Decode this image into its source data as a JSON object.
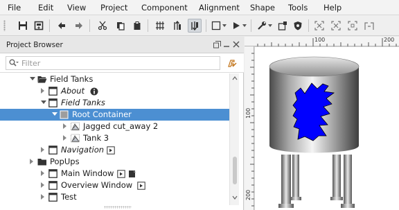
{
  "menu": {
    "file": "File",
    "edit": "Edit",
    "view": "View",
    "project": "Project",
    "component": "Component",
    "alignment": "Alignment",
    "shape": "Shape",
    "tools": "Tools",
    "help": "Help"
  },
  "toolbar": {
    "icons": [
      "save-icon",
      "save-all-icon",
      "back-icon",
      "forward-icon",
      "cut-icon",
      "copy-icon",
      "paste-icon",
      "group-icon",
      "bring-forward-icon",
      "send-backward-icon",
      "frame-icon",
      "dropdown-icon",
      "play-icon",
      "dropdown-icon",
      "wrench-icon",
      "dropdown-icon",
      "component-icon",
      "shield-icon",
      "expand-icon",
      "collapse-icon",
      "align-icon",
      "distribute-icon"
    ]
  },
  "project_browser": {
    "title": "Project Browser",
    "filter_placeholder": "Filter"
  },
  "tree": [
    {
      "label": "Field Tanks",
      "type": "folder",
      "expanded": true,
      "italic": false
    },
    {
      "label": "About",
      "type": "window",
      "expanded": false,
      "italic": true,
      "badge": "info-icon"
    },
    {
      "label": "Field Tanks",
      "type": "window",
      "expanded": true,
      "italic": true
    },
    {
      "label": "Root Container",
      "type": "container",
      "expanded": true,
      "italic": false,
      "selected": true
    },
    {
      "label": "Jagged cut_away 2",
      "type": "shape",
      "expanded": false,
      "italic": false
    },
    {
      "label": "Tank 3",
      "type": "shape",
      "expanded": false,
      "italic": false
    },
    {
      "label": "Navigation",
      "type": "window",
      "expanded": false,
      "italic": true,
      "badge": "docked-icon"
    },
    {
      "label": "PopUps",
      "type": "folder",
      "expanded": false,
      "italic": false
    },
    {
      "label": "Main Window",
      "type": "window",
      "expanded": false,
      "italic": false,
      "badge": "docked-icon"
    },
    {
      "label": "Overview Window",
      "type": "window",
      "expanded": false,
      "italic": false,
      "badge": "docked-icon"
    },
    {
      "label": "Test",
      "type": "window",
      "expanded": false,
      "italic": false
    }
  ],
  "rulers": {
    "top_labels": [
      "100",
      "200"
    ],
    "left_labels": [
      "100",
      "200"
    ]
  },
  "colors": {
    "selection": "#4c8fd2",
    "tank_liquid": "#0000ff",
    "folder": "#333333"
  }
}
